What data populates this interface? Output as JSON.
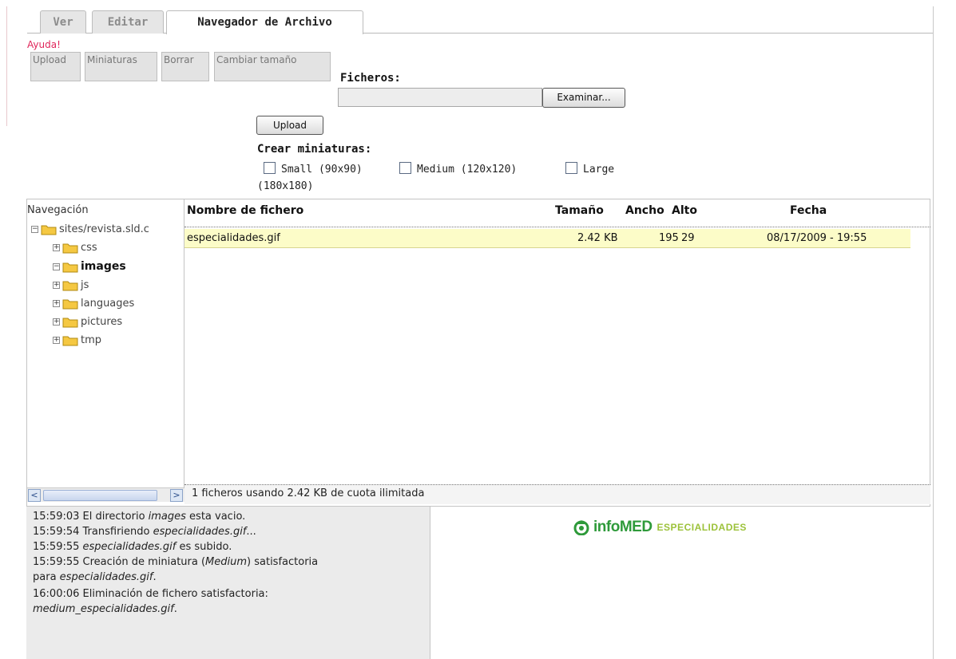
{
  "tabs": [
    {
      "label": "Ver"
    },
    {
      "label": "Editar"
    },
    {
      "label": "Navegador de Archivo"
    }
  ],
  "help_link": "Ayuda!",
  "toolbar": {
    "upload": "Upload",
    "thumbnails": "Miniaturas",
    "delete": "Borrar",
    "resize": "Cambiar tamaño"
  },
  "upload_form": {
    "files_label": "Ficheros:",
    "file_value": "",
    "browse_button": "Examinar...",
    "upload_button": "Upload",
    "thumbs_label": "Crear miniaturas:",
    "options": [
      {
        "label": "Small (90x90)",
        "checked": false
      },
      {
        "label": "Medium (120x120)",
        "checked": false
      },
      {
        "label": "Large",
        "checked": false
      }
    ],
    "options_wrap": "(180x180)"
  },
  "navigation": {
    "title": "Navegación",
    "root": "sites/revista.sld.c",
    "folders": [
      {
        "name": "css",
        "active": false
      },
      {
        "name": "images",
        "active": true
      },
      {
        "name": "js",
        "active": false
      },
      {
        "name": "languages",
        "active": false
      },
      {
        "name": "pictures",
        "active": false
      },
      {
        "name": "tmp",
        "active": false
      }
    ]
  },
  "file_list": {
    "columns": [
      "Nombre de fichero",
      "Tamaño",
      "Ancho",
      "Alto",
      "Fecha"
    ],
    "rows": [
      {
        "name": "especialidades.gif",
        "size": "2.42 KB",
        "width": "195",
        "height": "29",
        "date": "08/17/2009 - 19:55"
      }
    ],
    "status": "1 ficheros usando 2.42 KB de cuota ilimitada"
  },
  "log": [
    {
      "time": "15:59:03",
      "parts": [
        "El directorio ",
        "images",
        " esta vacio."
      ]
    },
    {
      "time": "15:59:54",
      "parts": [
        "Transfiriendo ",
        "especialidades.gif",
        "..."
      ]
    },
    {
      "time": "15:59:55",
      "parts": [
        "",
        "especialidades.gif",
        " es subido."
      ]
    },
    {
      "time": "15:59:55",
      "parts": [
        "Creación de miniatura (",
        "Medium",
        ") satisfactoria"
      ]
    },
    {
      "time": "",
      "parts": [
        "para ",
        "especialidades.gif",
        "."
      ]
    },
    {
      "time": "16:00:06",
      "parts": [
        "Eliminación de fichero satisfactoria:",
        "",
        ""
      ]
    },
    {
      "time": "",
      "parts": [
        "",
        "medium_especialidades.gif",
        "."
      ]
    }
  ],
  "preview": {
    "logo_word": "infoMED",
    "logo_sub": "ESPECIALIDADES",
    "logo_color": "#2e9a3a",
    "logo_sub_color": "#9cc23a"
  }
}
